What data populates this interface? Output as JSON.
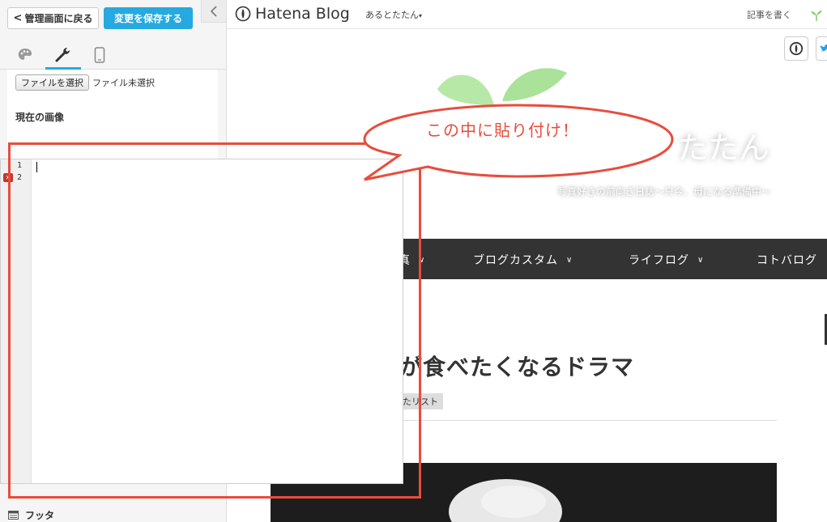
{
  "panel": {
    "back_label": "管理画面に戻る",
    "save_label": "変更を保存する",
    "file_button": "ファイルを選択",
    "file_status": "ファイル未選択",
    "current_image": "現在の画像",
    "footer_label": "フッタ"
  },
  "blog": {
    "service_name": "Hatena Blog",
    "user": "あるとたたん",
    "write": "記事を書く",
    "title_partial": "たたん",
    "description": "写真好きの前向き日誌〜只今、母になる準備中〜",
    "nav": [
      {
        "label": "真"
      },
      {
        "label": "ブログカスタム"
      },
      {
        "label": "ライフログ"
      },
      {
        "label": "コトバログ"
      }
    ],
    "post_title": "が食べたくなるドラマ",
    "category": "たリスト"
  },
  "editor": {
    "lines": [
      "1",
      "2"
    ]
  },
  "annotation": {
    "text": "この中に貼り付け！",
    "color": "#e84c3d"
  },
  "colors": {
    "accent": "#26a9e0",
    "nav_bg": "#333333"
  }
}
